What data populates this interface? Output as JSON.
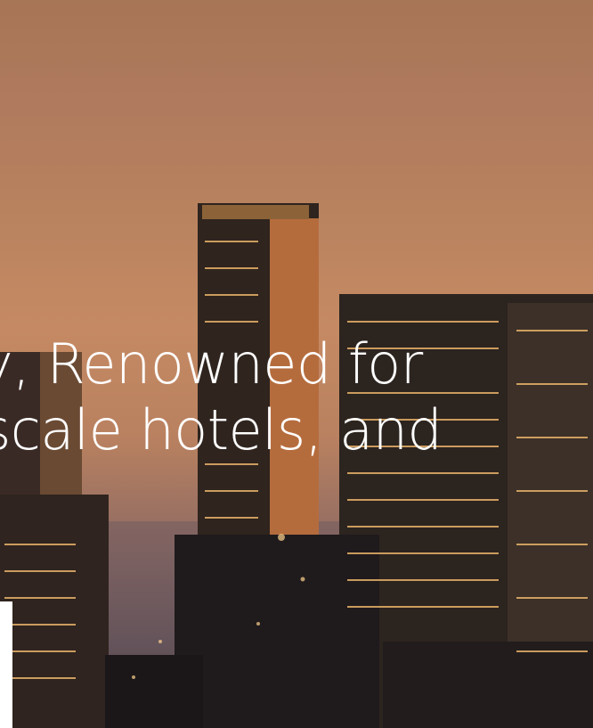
{
  "hero": {
    "line1": "y, Renowned for",
    "line2": "scale hotels, and"
  }
}
